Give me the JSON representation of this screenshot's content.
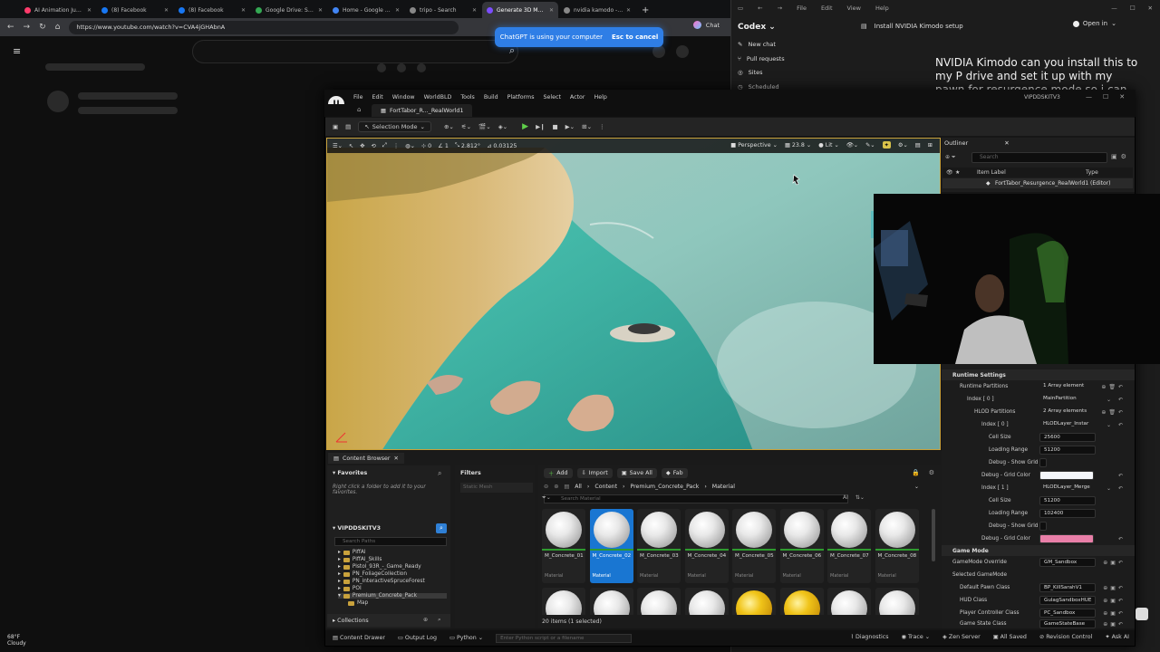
{
  "browser": {
    "tabs": [
      {
        "label": "AI Animation Just Got",
        "color": "#ff3b6b",
        "active": false
      },
      {
        "label": "(8) Facebook",
        "color": "#1877f2",
        "active": false
      },
      {
        "label": "(8) Facebook",
        "color": "#1877f2",
        "active": false
      },
      {
        "label": "Google Drive: Share",
        "color": "#34a853",
        "active": false
      },
      {
        "label": "Home - Google Drive",
        "color": "#4285f4",
        "active": false
      },
      {
        "label": "tripo - Search",
        "color": "#888888",
        "active": false
      },
      {
        "label": "Generate 3D Model",
        "color": "#7c4dff",
        "active": true
      },
      {
        "label": "nvidia kamodo - Sea",
        "color": "#888888",
        "active": false
      }
    ],
    "new_tab": "+",
    "url": "https://www.youtube.com/watch?v=CVA4jGHAbnA",
    "chat_label": "Chat",
    "window_controls": [
      "—",
      "☐",
      "✕"
    ]
  },
  "gpt_banner": {
    "text": "ChatGPT is using your computer",
    "action": "Esc to cancel"
  },
  "codex": {
    "menu": [
      "File",
      "Edit",
      "View",
      "Help"
    ],
    "title": "Codex",
    "items": [
      "New chat",
      "Pull requests",
      "Sites",
      "Scheduled"
    ],
    "thread_title": "Install NVIDIA Kimodo setup",
    "open_in": "Open in",
    "prompt": "NVIDIA Kimodo can you install this to my P drive and set it up with my pawn for resurgence mode so i can start using"
  },
  "ue": {
    "menu": [
      "File",
      "Edit",
      "Window",
      "WorldBLD",
      "Tools",
      "Build",
      "Platforms",
      "Select",
      "Actor",
      "Help"
    ],
    "project": "VIPDDSKITV3",
    "level_tab": "FortTabor_R..._RealWorld1",
    "toolbar": {
      "selection_mode": "Selection Mode"
    },
    "viewport": {
      "perspective": "Perspective",
      "fov": "23.8",
      "lit": "Lit",
      "grid": "0",
      "rotate": "1",
      "scale": "2.812°",
      "snap": "0.03125"
    },
    "outliner": {
      "tab": "Outliner",
      "search_placeholder": "Search",
      "col_label": "Item Label",
      "col_type": "Type",
      "row": "FortTabor_Resurgence_RealWorld1 (Editor)"
    },
    "details": {
      "runtime_settings": "Runtime Settings",
      "runtime_partitions": "Runtime Partitions",
      "runtime_partitions_val": "1 Array element",
      "index0": "Index [ 0 ]",
      "index0_val": "MainPartition",
      "hlod_partitions": "HLOD Partitions",
      "hlod_partitions_val": "2 Array elements",
      "hlod_index0": "Index [ 0 ]",
      "hlod_index0_val": "HLODLayer_Instar",
      "cell_size": "Cell Size",
      "cell_size_val": "25600",
      "loading_range": "Loading Range",
      "loading_range_val": "51200",
      "debug_show_grid": "Debug - Show Grid",
      "debug_grid_color": "Debug - Grid Color",
      "grid_color_1": "#f5f7fb",
      "hlod_index1": "Index [ 1 ]",
      "hlod_index1_val": "HLODLayer_Merge",
      "cell_size_val2": "51200",
      "loading_range_val2": "102400",
      "grid_color_2": "#e97fa8",
      "game_mode": "Game Mode",
      "gamemode_override": "GameMode Override",
      "gamemode_override_val": "GM_Sandbox",
      "selected_gamemode": "Selected GameMode",
      "default_pawn": "Default Pawn Class",
      "default_pawn_val": "BP_KillSarahV1",
      "hud_class": "HUD Class",
      "hud_class_val": "GulagSandboxHUE",
      "player_controller": "Player Controller Class",
      "player_controller_val": "PC_Sandbox",
      "game_state": "Game State Class",
      "game_state_val": "GameStateBase"
    },
    "content_browser": {
      "tab": "Content Browser",
      "add": "Add",
      "import": "Import",
      "save_all": "Save All",
      "fab": "Fab",
      "breadcrumb": [
        "All",
        "Content",
        "Premium_Concrete_Pack",
        "Material"
      ],
      "favorites": "Favorites",
      "favorites_hint": "Right click a folder to add it to your favorites.",
      "project_root": "VIPDDSKITV3",
      "search_paths": "Search Paths",
      "filters": "Filters",
      "filter_chip": "Static Mesh",
      "search_material": "Search Material",
      "collections": "Collections",
      "tree": [
        "PiffAI",
        "PiffAI_Skills",
        "Pistol_93R_-_Game_Ready",
        "PN_FoliageCollection",
        "PN_interactiveSpruceForest",
        "POI",
        "Premium_Concrete_Pack",
        "Map"
      ],
      "assets": [
        {
          "name": "M_Concrete_01",
          "type": "Material"
        },
        {
          "name": "M_Concrete_02",
          "type": "Material"
        },
        {
          "name": "M_Concrete_03",
          "type": "Material"
        },
        {
          "name": "M_Concrete_04",
          "type": "Material"
        },
        {
          "name": "M_Concrete_05",
          "type": "Material"
        },
        {
          "name": "M_Concrete_06",
          "type": "Material"
        },
        {
          "name": "M_Concrete_07",
          "type": "Material"
        },
        {
          "name": "M_Concrete_08",
          "type": "Material"
        }
      ],
      "selected_index": 1,
      "status": "20 items (1 selected)"
    },
    "statusbar": {
      "content_drawer": "Content Drawer",
      "output_log": "Output Log",
      "python": "Python",
      "cmd_placeholder": "Enter Python script or a filename",
      "diagnostics": "Diagnostics",
      "trace": "Trace",
      "zen": "Zen Server",
      "all_saved": "All Saved",
      "revision": "Revision Control",
      "ask_ai": "Ask AI"
    }
  },
  "taskbar": {
    "temp": "68°F",
    "weather": "Cloudy"
  }
}
